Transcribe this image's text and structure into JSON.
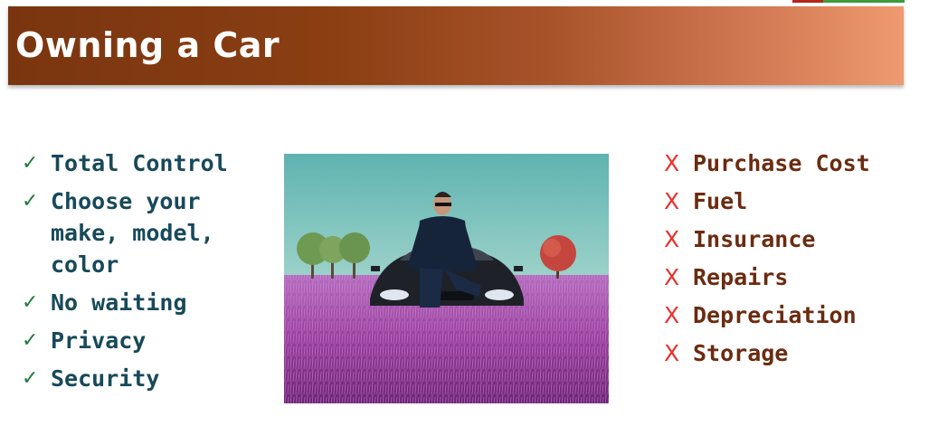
{
  "slide": {
    "title": "Owning a Car"
  },
  "pros": {
    "mark": "✓",
    "items": [
      {
        "text": "Total Control"
      },
      {
        "line1": "Choose your",
        "line2": "make, model,",
        "line3": "color"
      },
      {
        "text": "No waiting"
      },
      {
        "text": "Privacy"
      },
      {
        "text": "Security"
      }
    ]
  },
  "cons": {
    "mark": "X",
    "items": [
      {
        "text": "Purchase Cost"
      },
      {
        "text": "Fuel"
      },
      {
        "text": "Insurance"
      },
      {
        "text": "Repairs"
      },
      {
        "text": "Depreciation"
      },
      {
        "text": "Storage"
      }
    ]
  },
  "colors": {
    "title_gradient_start": "#7a3510",
    "title_gradient_end": "#ef9a70",
    "pro_text": "#17495a",
    "pro_check": "#1f7a3b",
    "con_text": "#6b2b10",
    "con_x": "#e5322d"
  },
  "icons": {
    "pro": "check-icon",
    "con": "x-icon"
  }
}
